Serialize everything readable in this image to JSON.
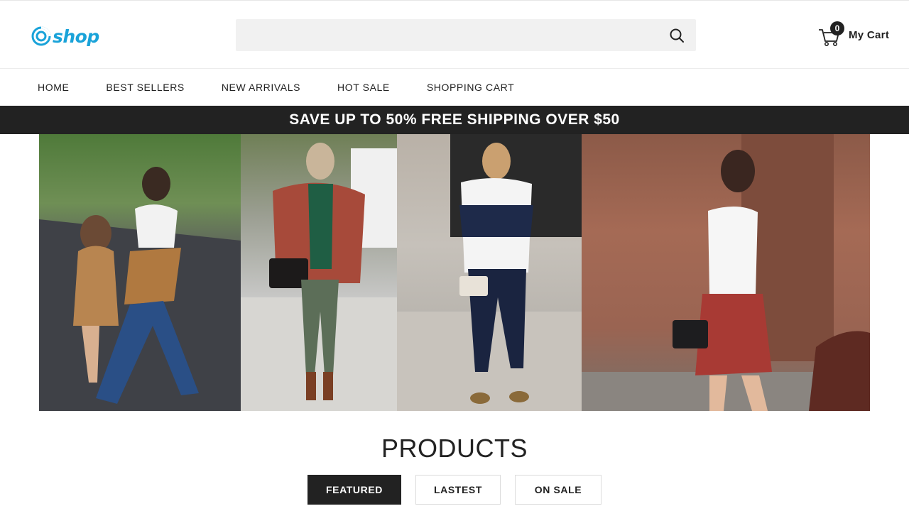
{
  "logo": {
    "text": "shop",
    "icon": "swirl-logo-icon"
  },
  "search": {
    "value": "",
    "placeholder": "",
    "icon": "search-icon"
  },
  "cart": {
    "count": "0",
    "label": "My Cart",
    "icon": "cart-icon"
  },
  "nav": {
    "items": [
      {
        "label": "HOME"
      },
      {
        "label": "BEST SELLERS"
      },
      {
        "label": "NEW ARRIVALS"
      },
      {
        "label": "HOT SALE"
      },
      {
        "label": "SHOPPING CART"
      }
    ]
  },
  "promo": {
    "text": "SAVE UP TO 50% FREE SHIPPING OVER $50"
  },
  "hero": {
    "panels": 4
  },
  "products": {
    "title": "PRODUCTS",
    "tabs": [
      {
        "label": "FEATURED",
        "active": true
      },
      {
        "label": "LASTEST",
        "active": false
      },
      {
        "label": "ON SALE",
        "active": false
      }
    ]
  },
  "colors": {
    "brand": "#1aa3d9",
    "dark": "#222222",
    "banner_bg": "#222222"
  }
}
